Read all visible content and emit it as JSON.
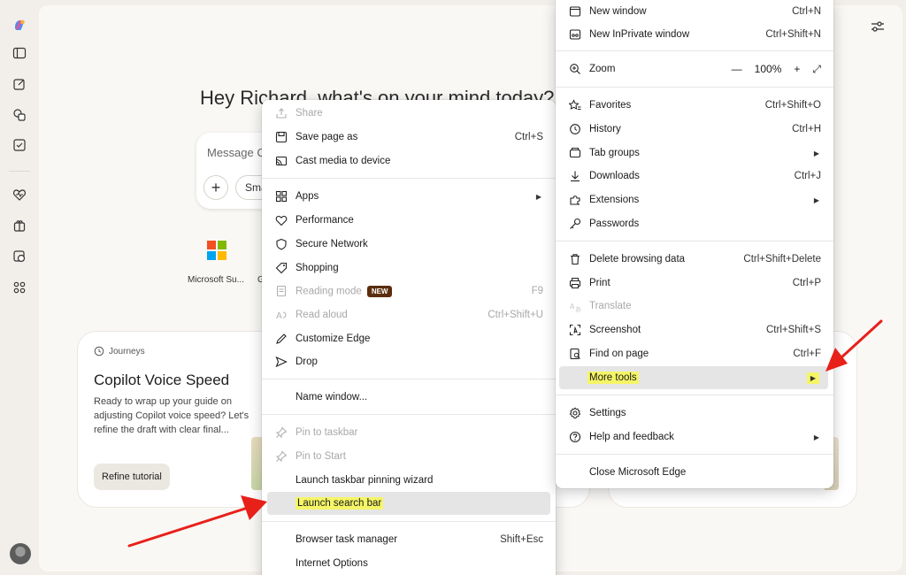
{
  "greeting": "Hey Richard, what's on your mind today?",
  "composer": {
    "placeholder": "Message Copilot",
    "plus": "+",
    "smart_label": "Smart"
  },
  "shortcuts": [
    {
      "label": "Microsoft Su..."
    },
    {
      "label": "G"
    }
  ],
  "journey": {
    "tag": "Journeys",
    "title": "Copilot Voice Speed",
    "description": "Ready to wrap up your guide on adjusting Copilot voice speed? Let's refine the draft with clear final...",
    "button": "Refine tutorial"
  },
  "main_menu": {
    "items": [
      {
        "label": "New window",
        "shortcut": "Ctrl+N",
        "icon": "window-icon"
      },
      {
        "label": "New InPrivate window",
        "shortcut": "Ctrl+Shift+N",
        "icon": "inprivate-icon"
      },
      {
        "label": "Zoom",
        "icon": "zoom-icon",
        "zoom_value": "100%",
        "zoom_minus": "—",
        "zoom_plus": "+"
      },
      {
        "label": "Favorites",
        "shortcut": "Ctrl+Shift+O",
        "icon": "favorites-icon"
      },
      {
        "label": "History",
        "shortcut": "Ctrl+H",
        "icon": "history-icon"
      },
      {
        "label": "Tab groups",
        "icon": "tab-groups-icon"
      },
      {
        "label": "Downloads",
        "shortcut": "Ctrl+J",
        "icon": "download-icon"
      },
      {
        "label": "Extensions",
        "icon": "extensions-icon"
      },
      {
        "label": "Passwords",
        "icon": "key-icon"
      },
      {
        "label": "Delete browsing data",
        "shortcut": "Ctrl+Shift+Delete",
        "icon": "trash-icon"
      },
      {
        "label": "Print",
        "shortcut": "Ctrl+P",
        "icon": "print-icon"
      },
      {
        "label": "Translate",
        "icon": "translate-icon"
      },
      {
        "label": "Screenshot",
        "shortcut": "Ctrl+Shift+S",
        "icon": "screenshot-icon"
      },
      {
        "label": "Find on page",
        "shortcut": "Ctrl+F",
        "icon": "find-icon"
      },
      {
        "label": "More tools"
      },
      {
        "label": "Settings",
        "icon": "gear-icon"
      },
      {
        "label": "Help and feedback",
        "icon": "help-icon"
      },
      {
        "label": "Close Microsoft Edge"
      }
    ]
  },
  "sub_menu": {
    "items": [
      {
        "label": "Share",
        "icon": "share-icon"
      },
      {
        "label": "Save page as",
        "shortcut": "Ctrl+S",
        "icon": "save-icon"
      },
      {
        "label": "Cast media to device",
        "icon": "cast-icon"
      },
      {
        "label": "Apps",
        "icon": "apps-icon"
      },
      {
        "label": "Performance",
        "icon": "performance-icon"
      },
      {
        "label": "Secure Network",
        "icon": "shield-icon"
      },
      {
        "label": "Shopping",
        "icon": "tag-icon"
      },
      {
        "label": "Reading mode",
        "badge": "NEW",
        "shortcut": "F9",
        "icon": "reading-icon"
      },
      {
        "label": "Read aloud",
        "shortcut": "Ctrl+Shift+U",
        "icon": "read-aloud-icon"
      },
      {
        "label": "Customize Edge",
        "icon": "pen-icon"
      },
      {
        "label": "Drop",
        "icon": "drop-icon"
      },
      {
        "label": "Name window..."
      },
      {
        "label": "Pin to taskbar",
        "icon": "pin-icon"
      },
      {
        "label": "Pin to Start",
        "icon": "pin-icon"
      },
      {
        "label": "Launch taskbar pinning wizard"
      },
      {
        "label": "Launch search bar"
      },
      {
        "label": "Browser task manager",
        "shortcut": "Shift+Esc"
      },
      {
        "label": "Internet Options"
      }
    ]
  },
  "colors": {
    "highlight": "#f5f567",
    "annotation_arrow": "#e8201a",
    "badge": "#5a2e0e"
  }
}
